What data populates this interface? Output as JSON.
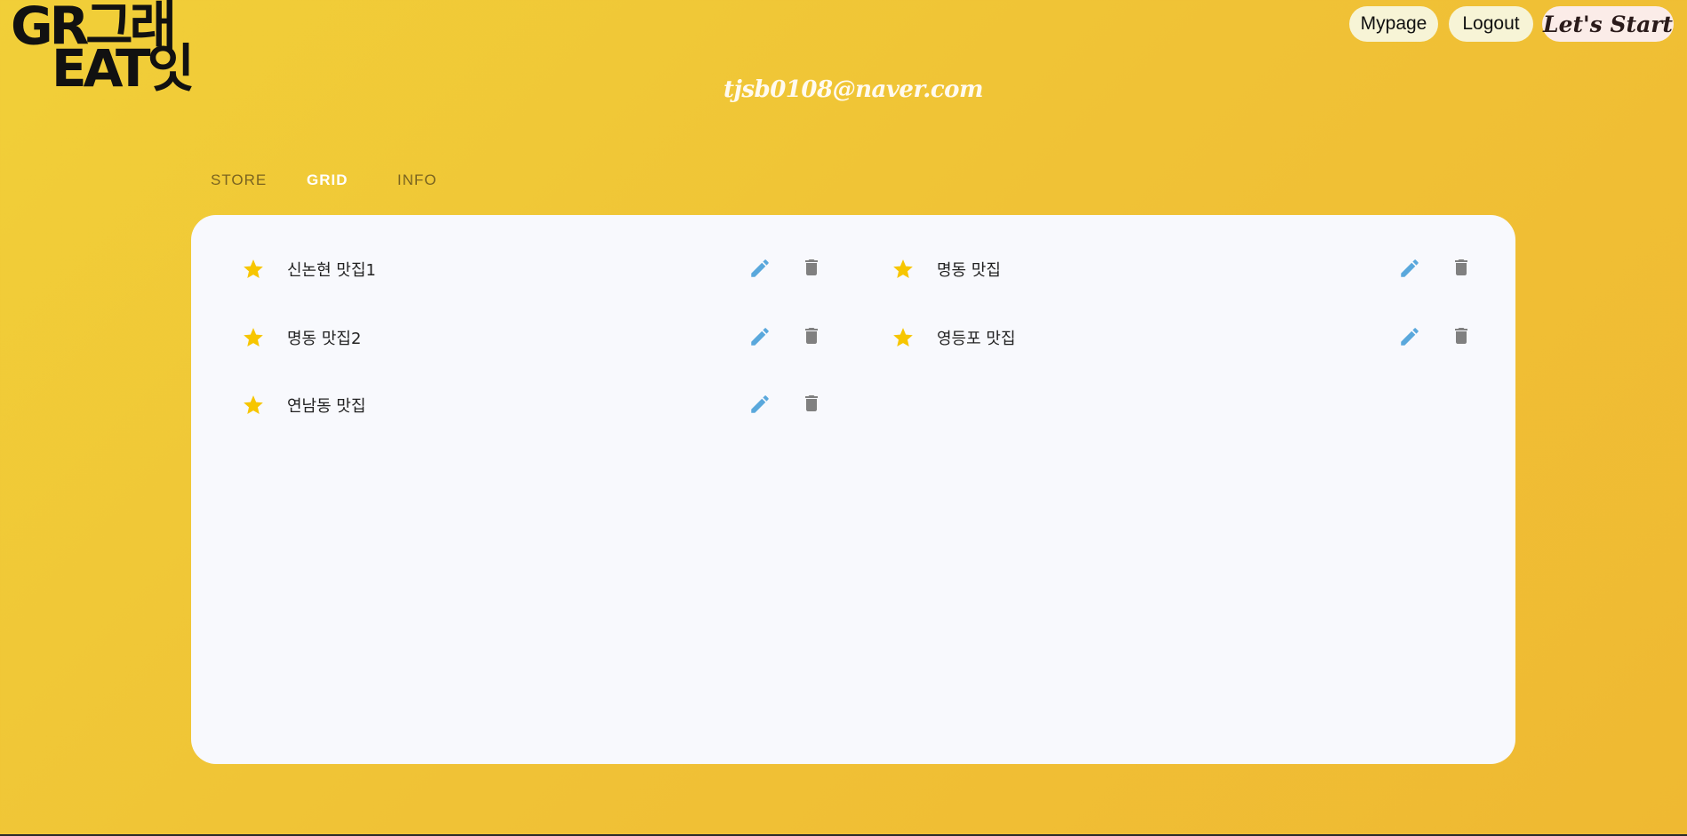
{
  "logo": {
    "line1": "GR그래",
    "line2": "EAT잇"
  },
  "header": {
    "mypage_label": "Mypage",
    "logout_label": "Logout",
    "start_label": "Let's Start",
    "user_email": "tjsb0108@naver.com"
  },
  "tabs": [
    {
      "label": "STORE",
      "active": false
    },
    {
      "label": "GRID",
      "active": true
    },
    {
      "label": "INFO",
      "active": false
    }
  ],
  "list": {
    "items": [
      {
        "name": "신논현 맛집1",
        "starred": true
      },
      {
        "name": "명동 맛집",
        "starred": true
      },
      {
        "name": "명동 맛집2",
        "starred": true
      },
      {
        "name": "영등포 맛집",
        "starred": true
      },
      {
        "name": "연남동 맛집",
        "starred": true
      }
    ]
  },
  "colors": {
    "star": "#f7c600",
    "edit": "#5aa8dc",
    "trash": "#808080",
    "active_tab": "#ffffff",
    "inactive_tab": "#7a6420"
  },
  "icons": {
    "star": "star-icon",
    "edit": "pencil-icon",
    "delete": "trash-icon"
  }
}
